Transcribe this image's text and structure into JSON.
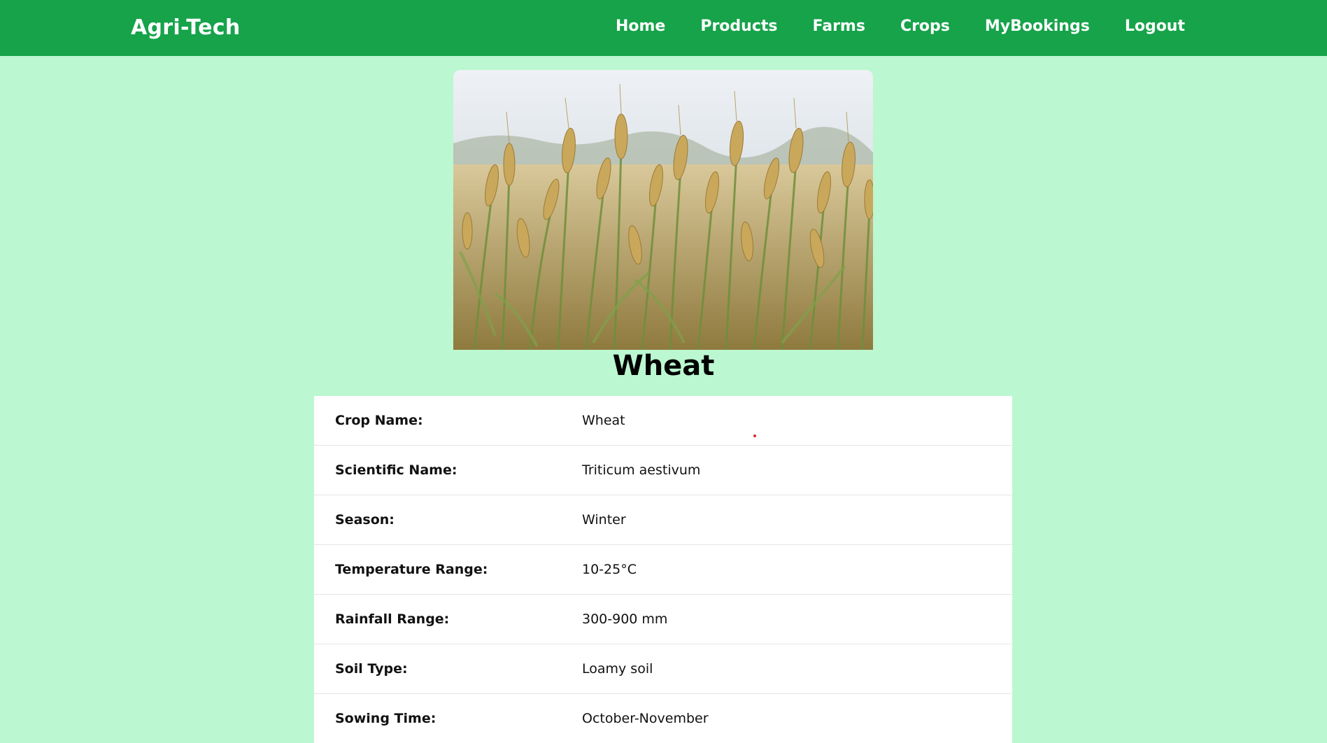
{
  "navbar": {
    "brand": "Agri-Tech",
    "links": [
      {
        "label": "Home"
      },
      {
        "label": "Products"
      },
      {
        "label": "Farms"
      },
      {
        "label": "Crops"
      },
      {
        "label": "MyBookings"
      },
      {
        "label": "Logout"
      }
    ],
    "bg_color": "#16a34a"
  },
  "page": {
    "bg_color": "#bbf7d0"
  },
  "crop": {
    "title": "Wheat",
    "image_icon": "wheat-field-photo",
    "details": [
      {
        "label": "Crop Name:",
        "value": "Wheat"
      },
      {
        "label": "Scientific Name:",
        "value": "Triticum aestivum"
      },
      {
        "label": "Season:",
        "value": "Winter"
      },
      {
        "label": "Temperature Range:",
        "value": "10-25°C"
      },
      {
        "label": "Rainfall Range:",
        "value": "300-900 mm"
      },
      {
        "label": "Soil Type:",
        "value": "Loamy soil"
      },
      {
        "label": "Sowing Time:",
        "value": "October-November"
      }
    ]
  }
}
